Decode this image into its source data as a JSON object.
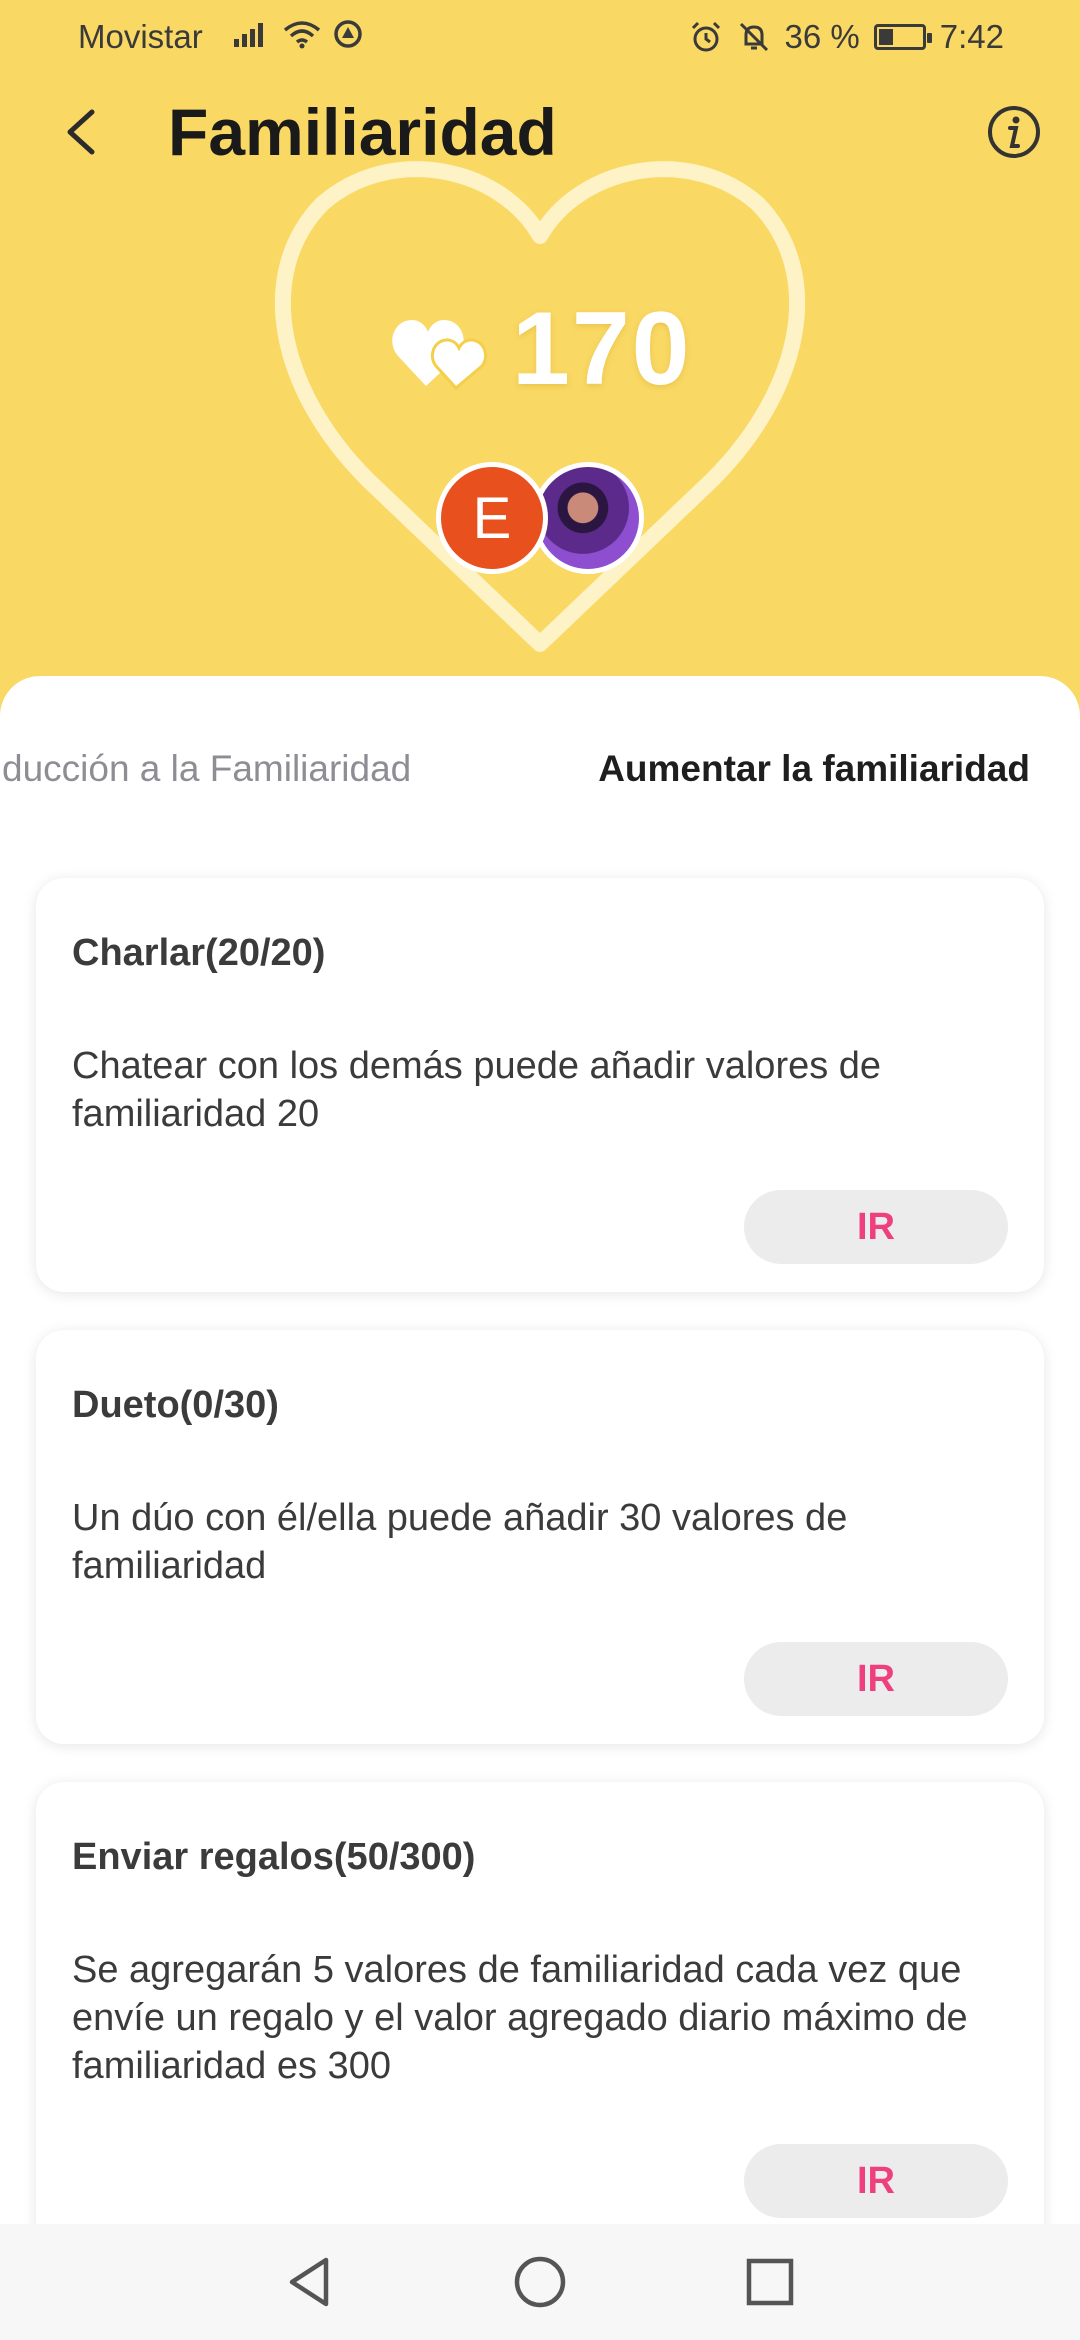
{
  "status_bar": {
    "carrier": "Movistar",
    "battery": "36 %",
    "time": "7:42",
    "icons": [
      "signal-icon",
      "wifi-icon",
      "sync-icon",
      "alarm-icon",
      "mute-icon",
      "battery-icon"
    ]
  },
  "header": {
    "title": "Familiaridad",
    "back_icon": "chevron-left-icon",
    "info_icon": "info-icon"
  },
  "familiarity": {
    "score": "170",
    "heart_icon": "hearts-icon",
    "avatar_initial": "E",
    "colors": {
      "background": "#f9d864",
      "avatar": "#e8501e",
      "accent": "#ee3f7e"
    }
  },
  "tabs": [
    {
      "label": "ducción a la Familiaridad",
      "active": false
    },
    {
      "label": "Aumentar la familiaridad",
      "active": true
    }
  ],
  "tasks": [
    {
      "title": "Charlar(20/20)",
      "description": "Chatear con los demás puede añadir valores de familiaridad 20",
      "button": "IR"
    },
    {
      "title": "Dueto(0/30)",
      "description": "Un dúo con él/ella puede añadir 30 valores de familiaridad",
      "button": "IR"
    },
    {
      "title": "Enviar regalos(50/300)",
      "description": "Se agregarán 5 valores de familiaridad cada vez que envíe un regalo y el valor agregado diario máximo de familiaridad es 300",
      "button": "IR"
    }
  ],
  "nav_bar": {
    "icons": [
      "back-triangle-icon",
      "home-circle-icon",
      "recents-square-icon"
    ]
  }
}
